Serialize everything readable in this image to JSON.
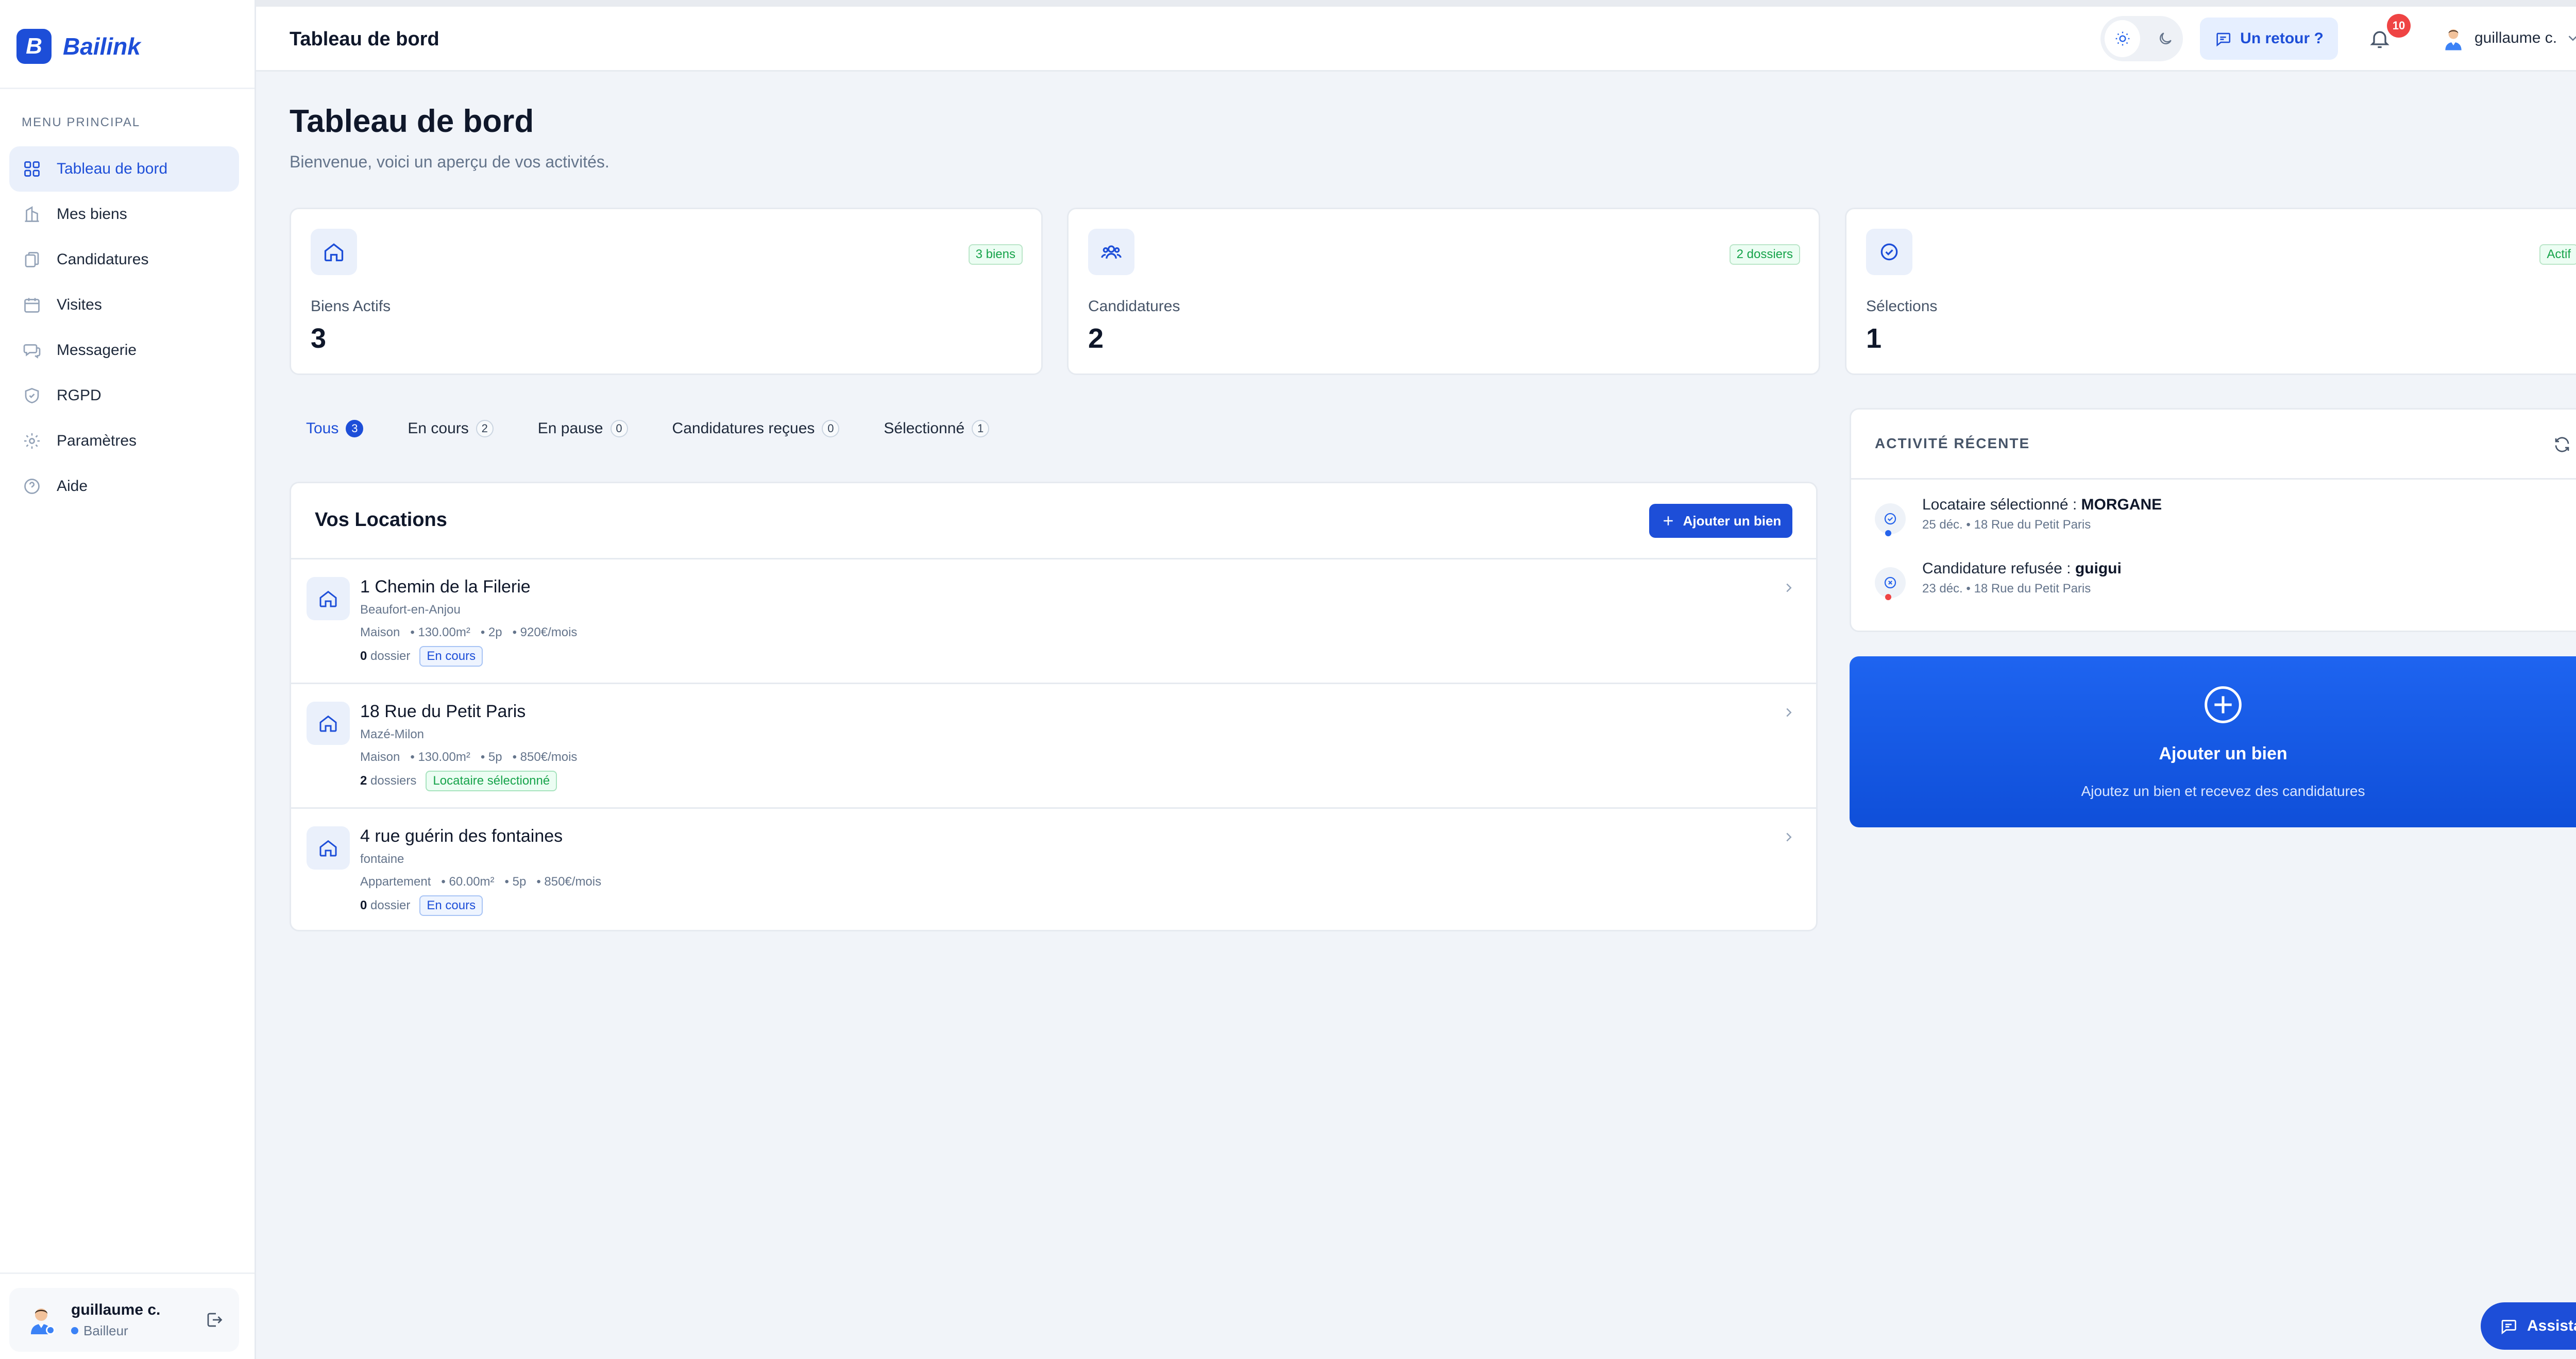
{
  "app": {
    "logo_letter": "B",
    "name": "Bailink"
  },
  "sidebar": {
    "heading": "MENU PRINCIPAL",
    "items": [
      {
        "label": "Tableau de bord",
        "icon": "grid-icon",
        "active": true
      },
      {
        "label": "Mes biens",
        "icon": "building-icon"
      },
      {
        "label": "Candidatures",
        "icon": "documents-icon"
      },
      {
        "label": "Visites",
        "icon": "calendar-icon"
      },
      {
        "label": "Messagerie",
        "icon": "chat-icon"
      },
      {
        "label": "RGPD",
        "icon": "shield-icon"
      },
      {
        "label": "Paramètres",
        "icon": "gear-icon"
      },
      {
        "label": "Aide",
        "icon": "help-icon"
      }
    ],
    "user": {
      "name": "guillaume c.",
      "role": "Bailleur"
    }
  },
  "header": {
    "title": "Tableau de bord",
    "feedback_label": "Un retour ?",
    "notifications_count": "10",
    "user_name": "guillaume c."
  },
  "page": {
    "title": "Tableau de bord",
    "subtitle": "Bienvenue, voici un aperçu de vos activités."
  },
  "stats": [
    {
      "badge": "3 biens",
      "label": "Biens Actifs",
      "value": "3",
      "icon": "home-icon"
    },
    {
      "badge": "2 dossiers",
      "label": "Candidatures",
      "value": "2",
      "icon": "users-icon"
    },
    {
      "badge": "Actif",
      "label": "Sélections",
      "value": "1",
      "icon": "check-circle-icon"
    }
  ],
  "tabs": [
    {
      "label": "Tous",
      "count": "3",
      "active": true
    },
    {
      "label": "En cours",
      "count": "2"
    },
    {
      "label": "En pause",
      "count": "0"
    },
    {
      "label": "Candidatures reçues",
      "count": "0"
    },
    {
      "label": "Sélectionné",
      "count": "1"
    }
  ],
  "locations": {
    "title": "Vos Locations",
    "add_label": "Ajouter un bien",
    "items": [
      {
        "name": "1 Chemin de la Filerie",
        "city": "Beaufort-en-Anjou",
        "type": "Maison",
        "area": "• 130.00m²",
        "rooms": "• 2p",
        "rent": "• 920€/mois",
        "dossier_count": "0",
        "dossier_word": "dossier",
        "status": "En cours",
        "status_color": "blue"
      },
      {
        "name": "18 Rue du Petit Paris",
        "city": "Mazé-Milon",
        "type": "Maison",
        "area": "• 130.00m²",
        "rooms": "• 5p",
        "rent": "• 850€/mois",
        "dossier_count": "2",
        "dossier_word": "dossiers",
        "status": "Locataire sélectionné",
        "status_color": "green"
      },
      {
        "name": "4 rue guérin des fontaines",
        "city": "fontaine",
        "type": "Appartement",
        "area": "• 60.00m²",
        "rooms": "• 5p",
        "rent": "• 850€/mois",
        "dossier_count": "0",
        "dossier_word": "dossier",
        "status": "En cours",
        "status_color": "blue"
      }
    ]
  },
  "activity": {
    "title": "ACTIVITÉ RÉCENTE",
    "items": [
      {
        "prefix": "Locataire sélectionné : ",
        "subject": "MORGANE",
        "meta": "25 déc. • 18 Rue du Petit Paris",
        "dot_color": "#2563eb"
      },
      {
        "prefix": "Candidature refusée : ",
        "subject": "guigui",
        "meta": "23 déc. • 18 Rue du Petit Paris",
        "dot_color": "#ef4444"
      }
    ]
  },
  "cta": {
    "title": "Ajouter un bien",
    "subtitle": "Ajoutez un bien et recevez des candidatures"
  },
  "assistant": {
    "label": "Assistant"
  }
}
